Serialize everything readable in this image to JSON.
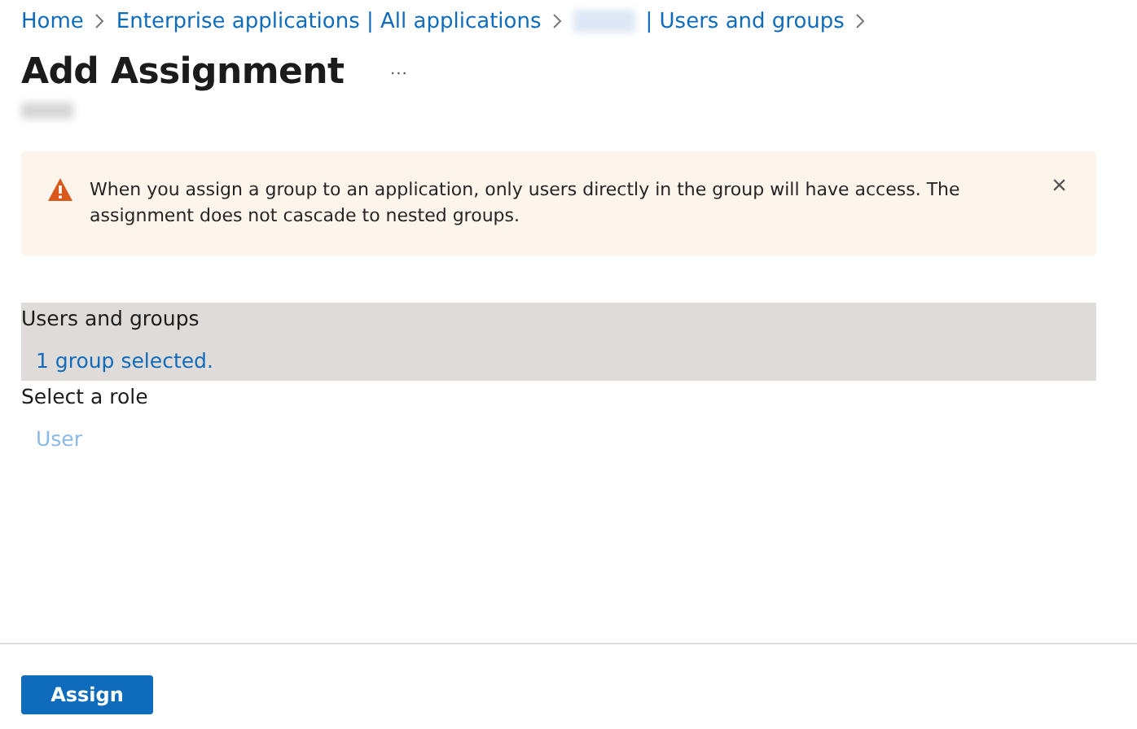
{
  "breadcrumb": [
    {
      "kind": "link",
      "label": "Home"
    },
    {
      "kind": "link",
      "label": "Enterprise applications | All applications"
    },
    {
      "kind": "redacted"
    },
    {
      "kind": "link",
      "label": "| Users and groups"
    }
  ],
  "title": "Add Assignment",
  "more_button": "···",
  "banner": {
    "message": "When you assign a group to an application, only users directly in the group will have access. The assignment does not cascade to nested groups.",
    "close": "×"
  },
  "sections": [
    {
      "label": "Users and groups",
      "value": "1 group selected.",
      "selected": true,
      "disabled": false
    },
    {
      "label": "Select a role",
      "value": "User",
      "selected": false,
      "disabled": true
    }
  ],
  "buttons": [
    {
      "label": "Assign",
      "kind": "primary"
    }
  ]
}
